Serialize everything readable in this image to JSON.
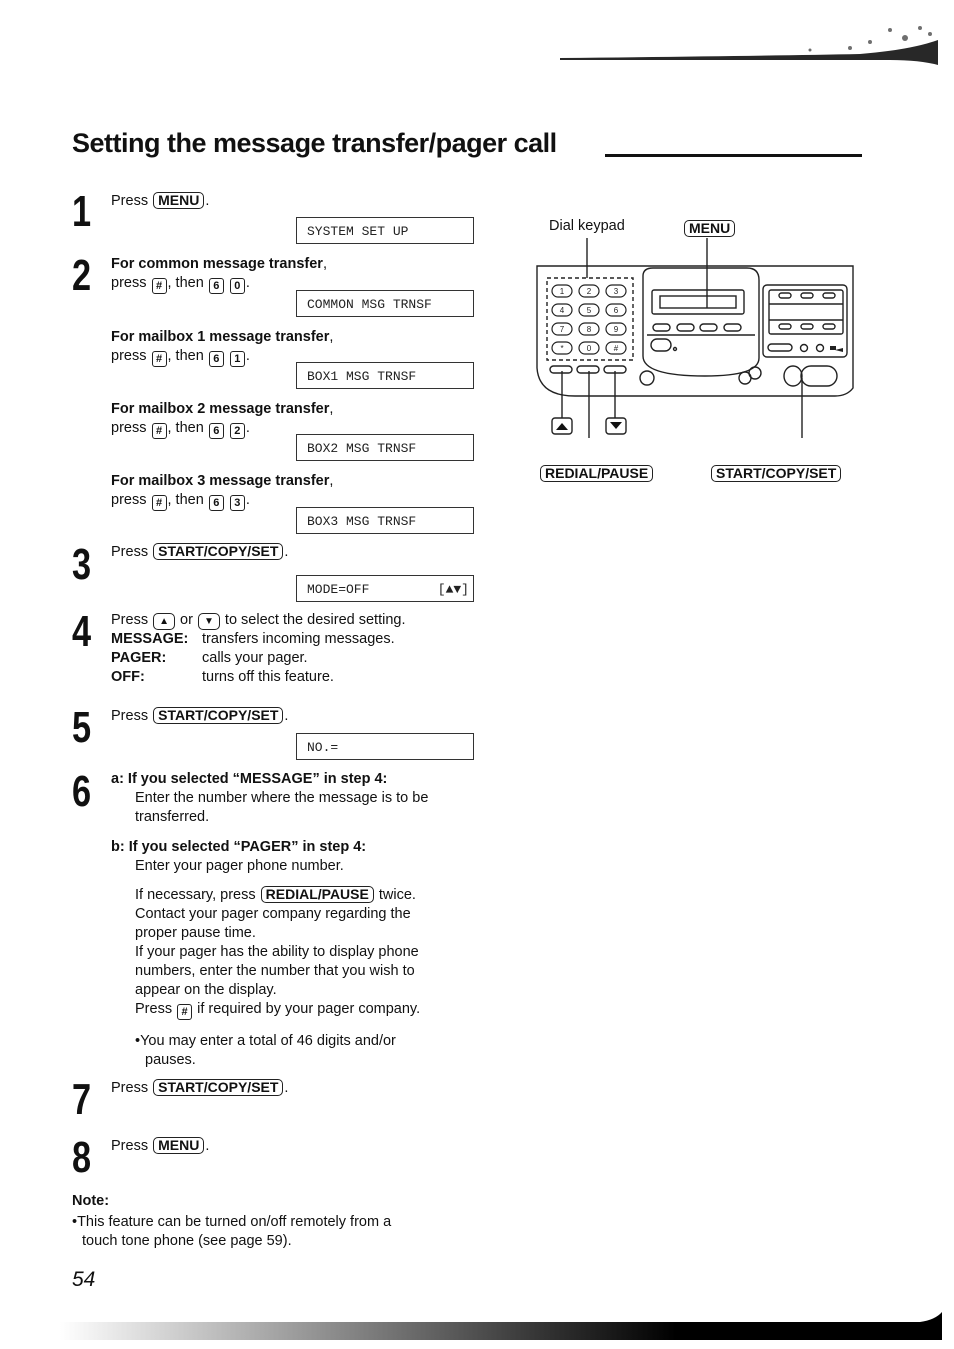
{
  "page": {
    "title": "Setting the message transfer/pager call",
    "page_number": "54"
  },
  "steps": {
    "s1": {
      "num": "1",
      "prefix": "Press",
      "key": "MENU",
      "suffix": ".",
      "display": "SYSTEM SET UP"
    },
    "s2": {
      "num": "2",
      "options": [
        {
          "heading": "For common message transfer",
          "press": "press",
          "hash": "#",
          "then": ", then",
          "k1": "6",
          "k2": "0",
          "display": "COMMON MSG TRNSF"
        },
        {
          "heading": "For mailbox 1 message transfer",
          "press": "press",
          "hash": "#",
          "then": ", then",
          "k1": "6",
          "k2": "1",
          "display": "BOX1 MSG TRNSF"
        },
        {
          "heading": "For mailbox 2 message transfer",
          "press": "press",
          "hash": "#",
          "then": ", then",
          "k1": "6",
          "k2": "2",
          "display": "BOX2 MSG TRNSF"
        },
        {
          "heading": "For mailbox 3 message transfer",
          "press": "press",
          "hash": "#",
          "then": ", then",
          "k1": "6",
          "k2": "3",
          "display": "BOX3 MSG TRNSF"
        }
      ]
    },
    "s3": {
      "num": "3",
      "prefix": "Press",
      "key": "START/COPY/SET",
      "suffix": ".",
      "display": "MODE=OFF",
      "display_right": "[▲▼]"
    },
    "s4": {
      "num": "4",
      "line": {
        "prefix": "Press",
        "up": "▲",
        "or": "or",
        "down": "▼",
        "suffix": "to select the desired setting."
      },
      "settings": [
        {
          "label": "MESSAGE:",
          "desc": "transfers incoming messages."
        },
        {
          "label": "PAGER:",
          "desc": "calls your pager."
        },
        {
          "label": "OFF:",
          "desc": "turns off this feature."
        }
      ]
    },
    "s5": {
      "num": "5",
      "prefix": "Press",
      "key": "START/COPY/SET",
      "suffix": ".",
      "display": "NO.="
    },
    "s6": {
      "num": "6",
      "a_heading": "a:  If you selected “MESSAGE” in step 4:",
      "a_text": [
        "Enter the number where the message is to be",
        "transferred."
      ],
      "b_heading": "b:  If you selected “PAGER” in step 4:",
      "b_text": "Enter your pager phone number.",
      "pause_prefix": "If necessary, press",
      "pause_key": "REDIAL/PAUSE",
      "pause_suffix": "twice.",
      "pause_lines": [
        "Contact your pager company regarding the",
        "proper pause time.",
        "If your pager has the ability to display phone",
        "numbers, enter the number that you wish to",
        "appear on the display."
      ],
      "hash_prefix": "Press",
      "hash_key": "#",
      "hash_suffix": "if required by your pager company.",
      "bullet": [
        "•You may enter a total of 46 digits and/or",
        "pauses."
      ]
    },
    "s7": {
      "num": "7",
      "prefix": "Press",
      "key": "START/COPY/SET",
      "suffix": "."
    },
    "s8": {
      "num": "8",
      "prefix": "Press",
      "key": "MENU",
      "suffix": "."
    }
  },
  "note": {
    "heading": "Note:",
    "lines": [
      "•This feature can be turned on/off remotely from a",
      "touch tone phone (see page 59)."
    ]
  },
  "diagram": {
    "label_keypad": "Dial keypad",
    "label_menu": "MENU",
    "label_redial": "REDIAL/PAUSE",
    "label_start": "START/COPY/SET",
    "up_key": "▲",
    "down_key": "▼",
    "keypad": [
      "1",
      "2",
      "3",
      "4",
      "5",
      "6",
      "7",
      "8",
      "9",
      "*",
      "0",
      "#"
    ]
  }
}
